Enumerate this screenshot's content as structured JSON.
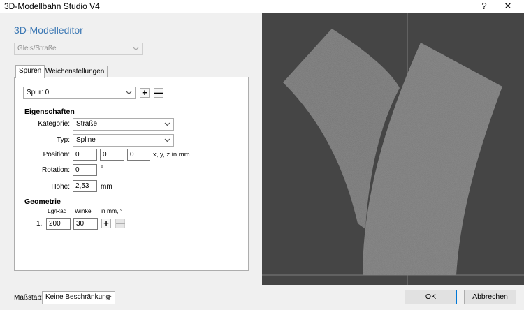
{
  "window": {
    "title": "3D-Modellbahn Studio V4",
    "help_label": "?",
    "close_label": "✕"
  },
  "editor": {
    "heading": "3D-Modelleditor",
    "type_select": "Gleis/Straße"
  },
  "tabs": [
    {
      "label": "Spuren"
    },
    {
      "label": "Weichenstellungen"
    }
  ],
  "spur": {
    "select_value": "Spur: 0",
    "add_label": "+",
    "remove_label": "—"
  },
  "eigenschaften": {
    "title": "Eigenschaften",
    "kategorie_label": "Kategorie:",
    "kategorie_value": "Straße",
    "typ_label": "Typ:",
    "typ_value": "Spline",
    "position_label": "Position:",
    "position_x": "0",
    "position_y": "0",
    "position_z": "0",
    "position_unit": "x, y, z in mm",
    "rotation_label": "Rotation:",
    "rotation_value": "0",
    "rotation_unit": "°",
    "hoehe_label": "Höhe:",
    "hoehe_value": "2,53",
    "hoehe_unit": "mm"
  },
  "geometrie": {
    "title": "Geometrie",
    "col1": "Lg/Rad",
    "col2": "Winkel",
    "unit": "in mm, °",
    "rows": [
      {
        "index": "1.",
        "length": "200",
        "angle": "30"
      }
    ],
    "add_label": "+",
    "remove_label": "—"
  },
  "footer": {
    "massstab_label": "Maßstab:",
    "massstab_value": "Keine Beschränkung",
    "ok_label": "OK",
    "cancel_label": "Abbrechen"
  },
  "colors": {
    "heading": "#3c78b4",
    "viewport_bg": "#454545",
    "road": "#777777",
    "default_button_border": "#0078d7"
  }
}
